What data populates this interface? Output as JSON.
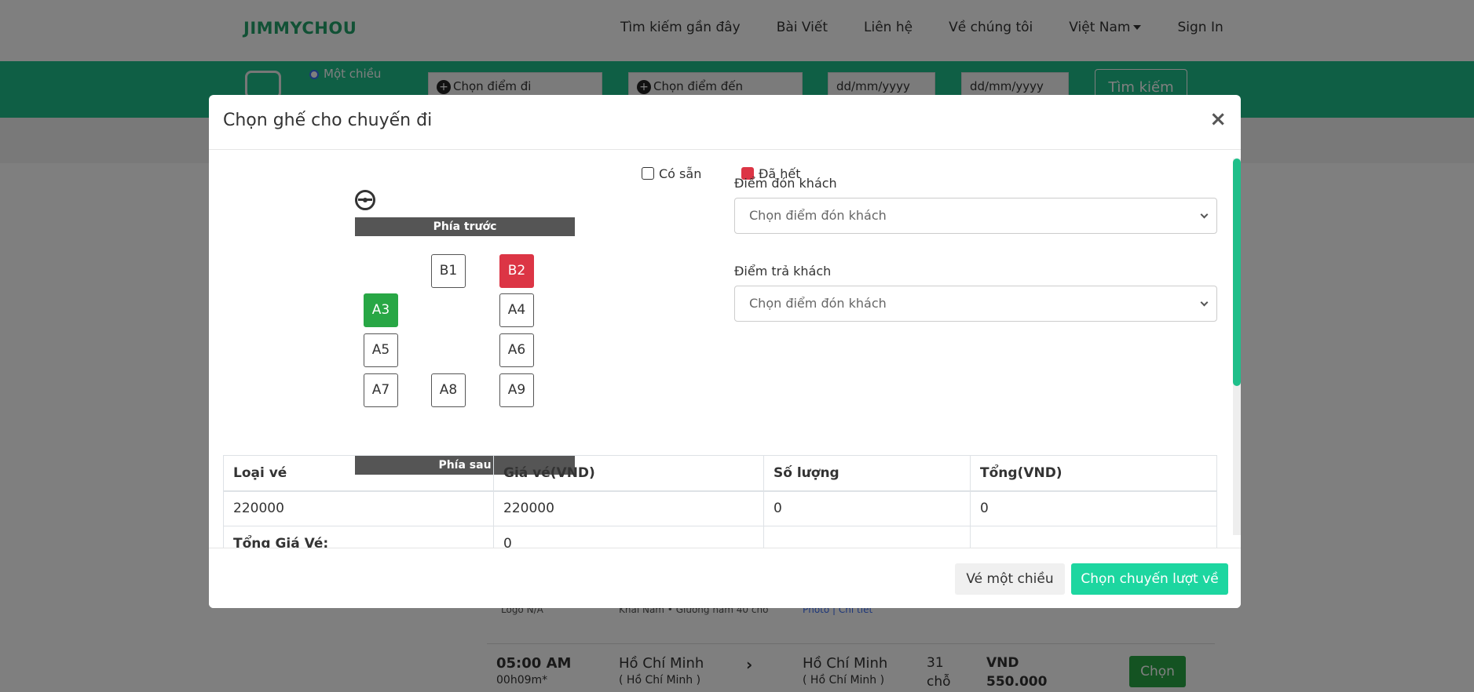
{
  "site": {
    "brand": "JIMMYCHOU"
  },
  "nav": {
    "items": [
      "Tìm kiếm gần đây",
      "Bài Viết",
      "Liên hệ",
      "Về chúng tôi"
    ],
    "language": "Việt Nam",
    "signin": "Sign In"
  },
  "search": {
    "trip_type": "Một chiều",
    "from_placeholder": "Chọn điểm đi",
    "to_placeholder": "Chọn điểm đến",
    "date1": "dd/mm/yyyy",
    "date2": "dd/mm/yyyy",
    "button": "Tìm kiếm"
  },
  "behind": {
    "logo": "Logo N/A",
    "bus_info": "Khải Nam • Giường nằm 40 chỗ",
    "photo_link": "Photo | Chi tiết",
    "trip": {
      "time": "05:00 AM",
      "duration": "00h09m*",
      "from_city": "Hồ Chí Minh",
      "from_province": "( Hồ Chí Minh )",
      "to_city": "Hồ Chí Minh",
      "to_province": "( Hồ Chí Minh )",
      "seats_num": "31",
      "seats_unit": "chỗ",
      "currency": "VND",
      "price": "550.000",
      "button": "Chọn"
    }
  },
  "modal": {
    "title": "Chọn ghế cho chuyến đi",
    "close": "×",
    "legend": {
      "available": "Có sẵn",
      "sold": "Đã hết"
    },
    "front_label": "Phía trước",
    "rear_label": "Phía sau",
    "seats": [
      {
        "id": "B1",
        "status": "available"
      },
      {
        "id": "B2",
        "status": "sold"
      },
      {
        "id": "A3",
        "status": "selected"
      },
      {
        "id": "A4",
        "status": "available"
      },
      {
        "id": "A5",
        "status": "available"
      },
      {
        "id": "A6",
        "status": "available"
      },
      {
        "id": "A7",
        "status": "available"
      },
      {
        "id": "A8",
        "status": "available"
      },
      {
        "id": "A9",
        "status": "available"
      }
    ],
    "pickup": {
      "label": "Điểm đón khách",
      "placeholder": "Chọn điểm đón khách"
    },
    "dropoff": {
      "label": "Điểm trả khách",
      "placeholder": "Chọn điểm đón khách"
    },
    "table": {
      "headers": [
        "Loại vé",
        "Giá vé(VND)",
        "Số lượng",
        "Tổng(VND)"
      ],
      "row": [
        "220000",
        "220000",
        "0",
        "0"
      ],
      "total_label": "Tổng Giá Vé:",
      "total_value": "0"
    },
    "footer": {
      "one_way": "Vé một chiều",
      "choose_return": "Chọn chuyến lượt về"
    }
  },
  "colors": {
    "brand": "#22a36a",
    "searchbar": "#1fbf8a",
    "sold": "#dc3545",
    "selected": "#28a745",
    "primary_button": "#1dd6a0"
  }
}
